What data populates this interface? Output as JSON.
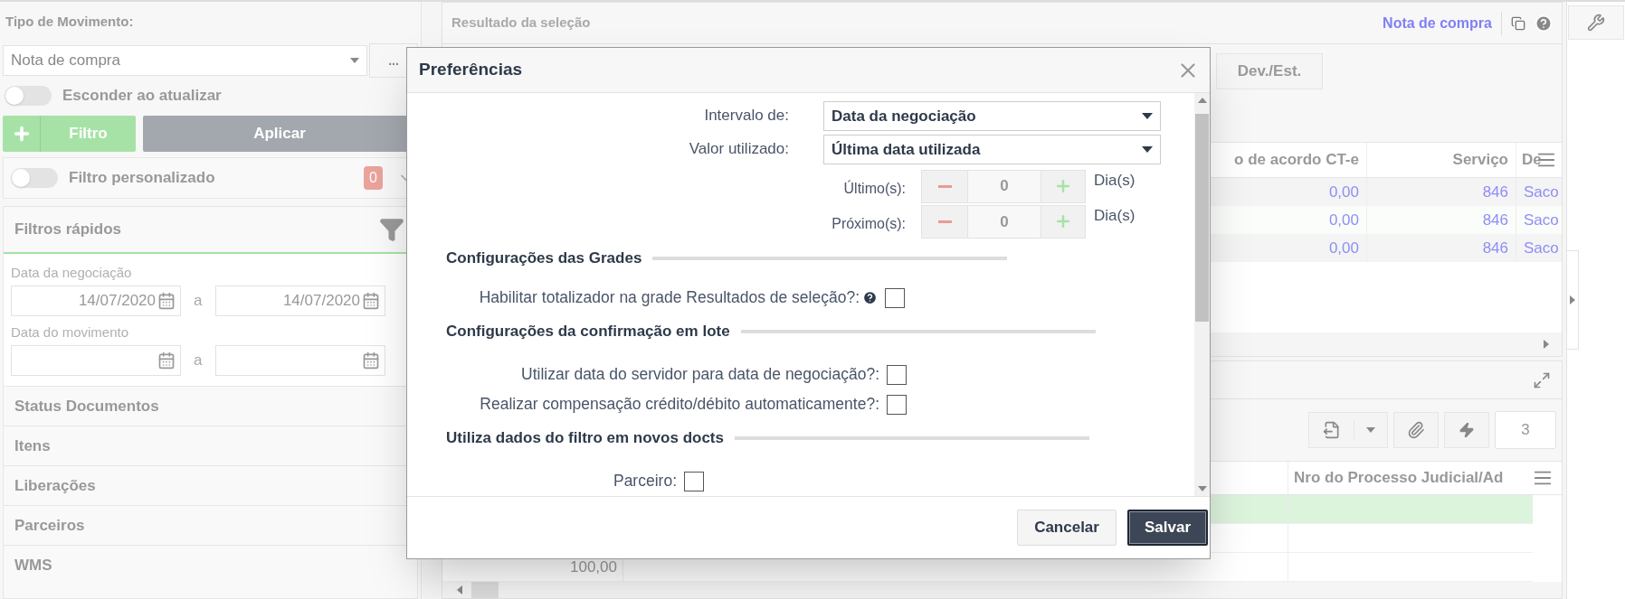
{
  "sidebar": {
    "movement_type": {
      "label": "Tipo de Movimento:",
      "value": "Nota de compra",
      "more_button": "..."
    },
    "hide_on_update": {
      "label": "Esconder ao atualizar",
      "on": false
    },
    "filter_button": "Filtro",
    "apply_button": "Aplicar",
    "custom_filter": {
      "label": "Filtro personalizado",
      "on": false,
      "count": "0"
    },
    "quick_filters": {
      "title": "Filtros rápidos",
      "fields": [
        {
          "label": "Data da negociação",
          "from": "14/07/2020",
          "separator": "a",
          "to": "14/07/2020"
        },
        {
          "label": "Data do movimento",
          "separator": "a"
        }
      ]
    },
    "sections": [
      "Status Documentos",
      "Itens",
      "Liberações",
      "Parceiros",
      "WMS"
    ]
  },
  "results": {
    "title": "Resultado da seleção",
    "link": "Nota de compra",
    "tab": "Dev./Est.",
    "columns": [
      "o de acordo CT-e",
      "Serviço",
      "De"
    ],
    "rows": [
      [
        "0,00",
        "846",
        "Saco"
      ],
      [
        "0,00",
        "846",
        "Saco"
      ],
      [
        "0,00",
        "846",
        "Saco"
      ]
    ]
  },
  "details": {
    "count": "3",
    "column": "Nro do Processo Judicial/Ad",
    "rows": [
      {
        "selected": true
      },
      {
        "selected": false
      },
      {
        "selected": false,
        "amount": "100,00"
      }
    ]
  },
  "dialog": {
    "title": "Preferências",
    "fields": [
      {
        "kind": "select",
        "label": "Intervalo de:",
        "value": "Data da negociação"
      },
      {
        "kind": "select",
        "label": "Valor utilizado:",
        "value": "Última data utilizada"
      },
      {
        "kind": "stepper",
        "label": "Último(s):",
        "value": "0",
        "unit": "Dia(s)"
      },
      {
        "kind": "stepper",
        "label": "Próximo(s):",
        "value": "0",
        "unit": "Dia(s)"
      }
    ],
    "groups": [
      {
        "title": "Configurações das Grades",
        "options": [
          {
            "label": "Habilitar totalizador na grade Resultados de seleção?:",
            "help": true,
            "checked": false
          }
        ]
      },
      {
        "title": "Configurações da confirmação em lote",
        "options": [
          {
            "label": "Utilizar data do servidor para data de negociação?:",
            "help": false,
            "checked": false
          },
          {
            "label": "Realizar compensação crédito/débito automaticamente?:",
            "help": false,
            "checked": false
          }
        ]
      },
      {
        "title": "Utiliza dados do filtro em novos docts",
        "options": [
          {
            "label": "Parceiro:",
            "help": false,
            "checked": false
          }
        ]
      }
    ],
    "buttons": [
      {
        "label": "Cancelar",
        "kind": "secondary"
      },
      {
        "label": "Salvar",
        "kind": "primary"
      }
    ]
  }
}
